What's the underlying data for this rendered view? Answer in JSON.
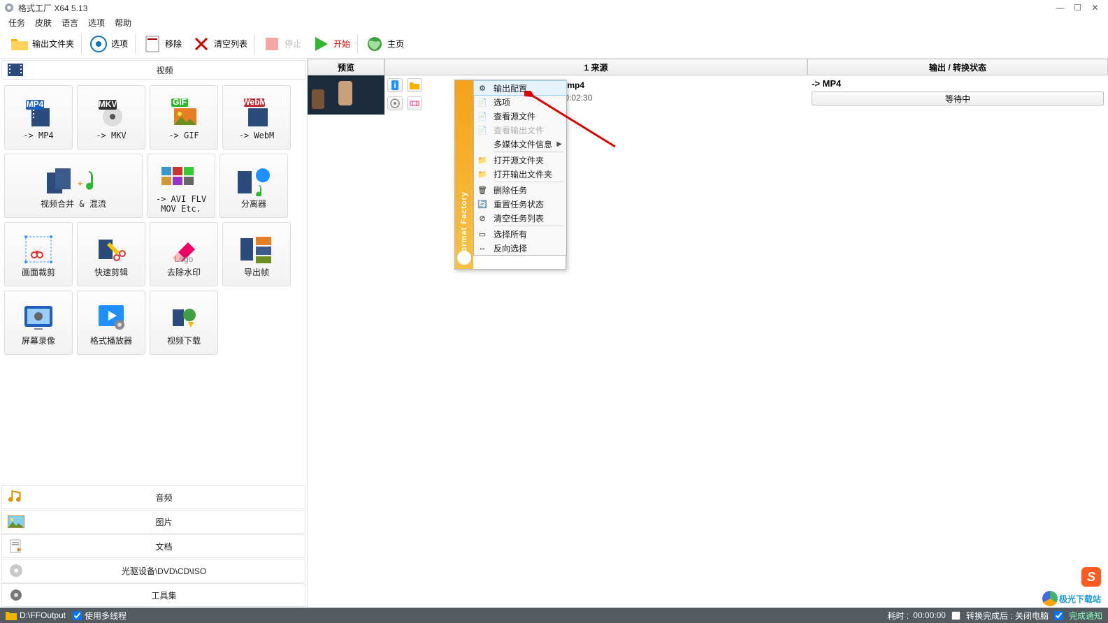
{
  "window": {
    "title": "格式工厂 X64 5.13"
  },
  "menu": {
    "task": "任务",
    "skin": "皮肤",
    "lang": "语言",
    "option": "选项",
    "help": "帮助"
  },
  "toolbar": {
    "output_folder": "输出文件夹",
    "option": "选项",
    "remove": "移除",
    "clear": "清空列表",
    "stop": "停止",
    "start": "开始",
    "home": "主页"
  },
  "categories": {
    "video": "视频",
    "audio": "音频",
    "image": "图片",
    "document": "文档",
    "disc": "光驱设备\\DVD\\CD\\ISO",
    "tools": "工具集"
  },
  "tiles": [
    {
      "label": "-> MP4",
      "icon": "mp4"
    },
    {
      "label": "-> MKV",
      "icon": "mkv"
    },
    {
      "label": "-> GIF",
      "icon": "gif"
    },
    {
      "label": "-> WebM",
      "icon": "webm"
    },
    {
      "label": "视频合并 & 混流",
      "icon": "merge"
    },
    {
      "label": "-> AVI FLV\nMOV Etc.",
      "icon": "avi"
    },
    {
      "label": "分离器",
      "icon": "split"
    },
    {
      "label": "画面裁剪",
      "icon": "crop"
    },
    {
      "label": "快速剪辑",
      "icon": "cut"
    },
    {
      "label": "去除水印",
      "icon": "eraser"
    },
    {
      "label": "导出帧",
      "icon": "frames"
    },
    {
      "label": "屏幕录像",
      "icon": "record"
    },
    {
      "label": "格式播放器",
      "icon": "player"
    },
    {
      "label": "视频下载",
      "icon": "download"
    }
  ],
  "table": {
    "preview": "预览",
    "source_header": "1 来源",
    "status_header": "输出 / 转换状态"
  },
  "task": {
    "filename_prefix": "",
    "filename_suffix": "-1-30032.mp4",
    "meta_suffix": "9Kbps, 00:02:30",
    "out_format": "-> MP4",
    "status": "等待中"
  },
  "context": {
    "brand": "Format Factory",
    "items": [
      {
        "label": "输出配置",
        "icon": "gear",
        "hover": true
      },
      {
        "label": "选项",
        "icon": "option"
      },
      {
        "label": "查看源文件",
        "icon": "page"
      },
      {
        "label": "查看输出文件",
        "icon": "page",
        "disabled": true
      },
      {
        "label": "多媒体文件信息",
        "icon": "",
        "submenu": true
      },
      {
        "sep": true
      },
      {
        "label": "打开源文件夹",
        "icon": "folder"
      },
      {
        "label": "打开输出文件夹",
        "icon": "folder"
      },
      {
        "sep": true
      },
      {
        "label": "删除任务",
        "icon": "delete"
      },
      {
        "label": "重置任务状态",
        "icon": "reset"
      },
      {
        "label": "清空任务列表",
        "icon": "clear"
      },
      {
        "sep": true
      },
      {
        "label": "选择所有",
        "icon": "select"
      },
      {
        "label": "反向选择",
        "icon": "invert"
      }
    ]
  },
  "status": {
    "output_path": "D:\\FFOutput",
    "multithread": "使用多线程",
    "elapsed_label": "耗时 :",
    "elapsed": "00:00:00",
    "shutdown": "转换完成后 : 关闭电脑",
    "notify": "完成通知"
  },
  "watermark": {
    "sogou": "S",
    "site": "极光下载站"
  }
}
